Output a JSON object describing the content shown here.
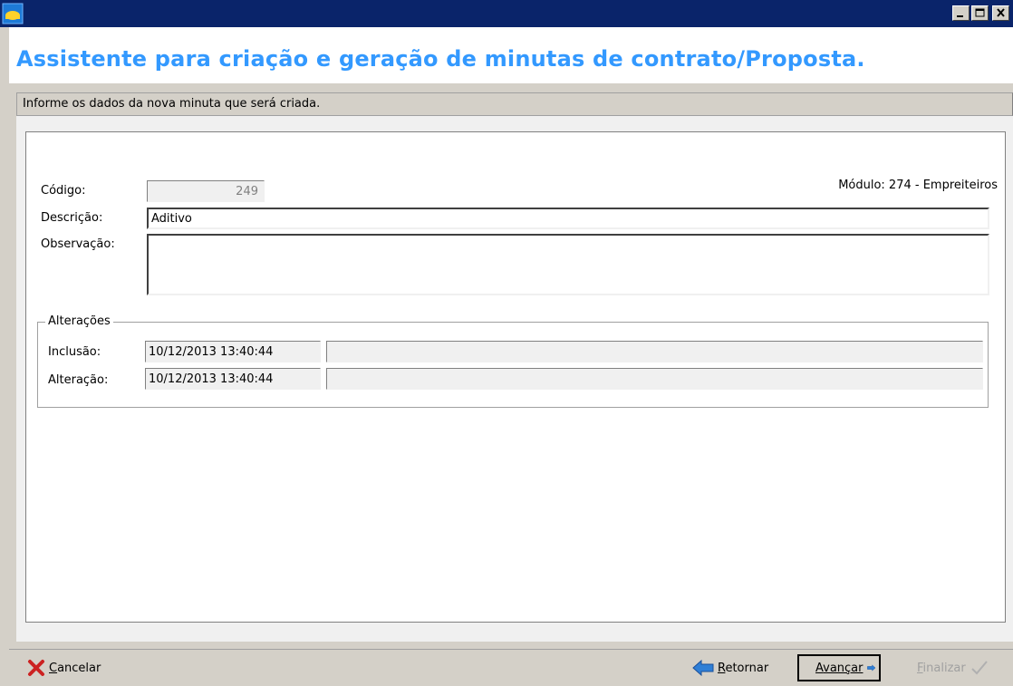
{
  "header": {
    "title": "Assistente para criação e geração de minutas de contrato/Proposta."
  },
  "info": {
    "text": "Informe os dados da nova minuta que será criada."
  },
  "form": {
    "codigo_label": "Código:",
    "codigo_value": "249",
    "modulo_text": "Módulo: 274 - Empreiteiros",
    "descricao_label": "Descrição:",
    "descricao_value": "Aditivo",
    "observacao_label": "Observação:",
    "observacao_value": ""
  },
  "alteracoes": {
    "legend": "Alterações",
    "inclusao_label": "Inclusão:",
    "inclusao_date": "10/12/2013 13:40:44",
    "inclusao_user": "",
    "alteracao_label": "Alteração:",
    "alteracao_date": "10/12/2013 13:40:44",
    "alteracao_user": ""
  },
  "footer": {
    "cancel_first": "C",
    "cancel_rest": "ancelar",
    "back_first": "R",
    "back_rest": "etornar",
    "next_first": "A",
    "next_rest": "vançar",
    "finish_first": "F",
    "finish_rest": "inalizar"
  },
  "colors": {
    "title_blue": "#3399ff",
    "titlebar": "#0a246a",
    "cancel_red": "#cc2222",
    "arrow_blue": "#2f7fd6"
  },
  "icons": [
    "app-icon",
    "minimize-icon",
    "maximize-icon",
    "close-icon",
    "cancel-x-icon",
    "back-arrow-icon",
    "forward-arrow-icon",
    "check-icon"
  ]
}
